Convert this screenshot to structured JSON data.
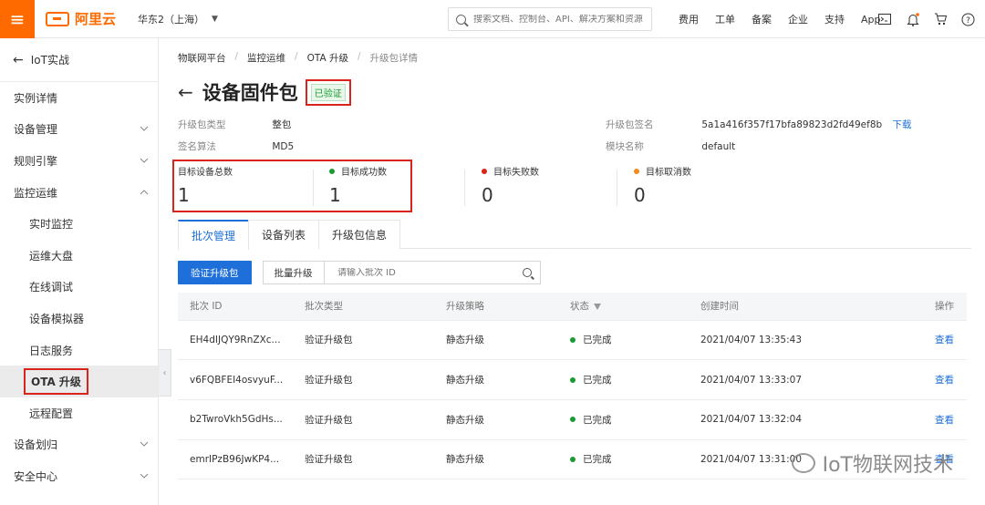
{
  "topbar": {
    "logo_text": "阿里云",
    "region": "华东2（上海）",
    "search_placeholder": "搜索文档、控制台、API、解决方案和资源",
    "links": [
      "费用",
      "工单",
      "备案",
      "企业",
      "支持",
      "App"
    ],
    "icons": [
      "terminal-icon",
      "bell-icon",
      "cart-icon",
      "help-icon"
    ],
    "accent": "#ff6a00"
  },
  "sidebar": {
    "back_label": "IoT实战",
    "items": [
      {
        "label": "实例详情",
        "chevron": false,
        "sub": false
      },
      {
        "label": "设备管理",
        "chevron": "down",
        "sub": false
      },
      {
        "label": "规则引擎",
        "chevron": "down",
        "sub": false
      },
      {
        "label": "监控运维",
        "chevron": "up",
        "sub": false
      },
      {
        "label": "实时监控",
        "chevron": false,
        "sub": true
      },
      {
        "label": "运维大盘",
        "chevron": false,
        "sub": true
      },
      {
        "label": "在线调试",
        "chevron": false,
        "sub": true
      },
      {
        "label": "设备模拟器",
        "chevron": false,
        "sub": true
      },
      {
        "label": "日志服务",
        "chevron": false,
        "sub": true
      },
      {
        "label": "OTA 升级",
        "chevron": false,
        "sub": true,
        "active": true
      },
      {
        "label": "远程配置",
        "chevron": false,
        "sub": true
      },
      {
        "label": "设备划归",
        "chevron": "down",
        "sub": false
      },
      {
        "label": "安全中心",
        "chevron": "down",
        "sub": false
      }
    ]
  },
  "breadcrumb": [
    "物联网平台",
    "监控运维",
    "OTA 升级",
    "升级包详情"
  ],
  "page": {
    "title": "设备固件包",
    "status_badge": "已验证"
  },
  "meta": {
    "pkg_type_label": "升级包类型",
    "pkg_type_value": "整包",
    "sign_algo_label": "签名算法",
    "sign_algo_value": "MD5",
    "signature_label": "升级包签名",
    "signature_value": "5a1a416f357f17bfa89823d2fd49ef8b",
    "download_label": "下载",
    "module_label": "模块名称",
    "module_value": "default"
  },
  "stats": [
    {
      "label": "目标设备总数",
      "value": "1",
      "dot": null
    },
    {
      "label": "目标成功数",
      "value": "1",
      "dot": "#1a9c32"
    },
    {
      "label": "目标失败数",
      "value": "0",
      "dot": "#d9241b"
    },
    {
      "label": "目标取消数",
      "value": "0",
      "dot": "#f08c1a"
    }
  ],
  "tabs": [
    "批次管理",
    "设备列表",
    "升级包信息"
  ],
  "toolbar": {
    "verify_button": "验证升级包",
    "batch_button": "批量升级",
    "batch_search_placeholder": "请输入批次 ID"
  },
  "table": {
    "headers": [
      "批次 ID",
      "批次类型",
      "升级策略",
      "状态",
      "创建时间",
      "操作"
    ],
    "rows": [
      {
        "id": "EH4dIJQY9RnZXc...",
        "type": "验证升级包",
        "strategy": "静态升级",
        "status": "已完成",
        "time": "2021/04/07 13:35:43",
        "action": "查看"
      },
      {
        "id": "v6FQBFEI4osvyuF...",
        "type": "验证升级包",
        "strategy": "静态升级",
        "status": "已完成",
        "time": "2021/04/07 13:33:07",
        "action": "查看"
      },
      {
        "id": "b2TwroVkh5GdHs...",
        "type": "验证升级包",
        "strategy": "静态升级",
        "status": "已完成",
        "time": "2021/04/07 13:32:04",
        "action": "查看"
      },
      {
        "id": "emrIPzB96JwKP4...",
        "type": "验证升级包",
        "strategy": "静态升级",
        "status": "已完成",
        "time": "2021/04/07 13:31:00",
        "action": "查看"
      }
    ]
  },
  "watermark": "IoT物联网技术"
}
